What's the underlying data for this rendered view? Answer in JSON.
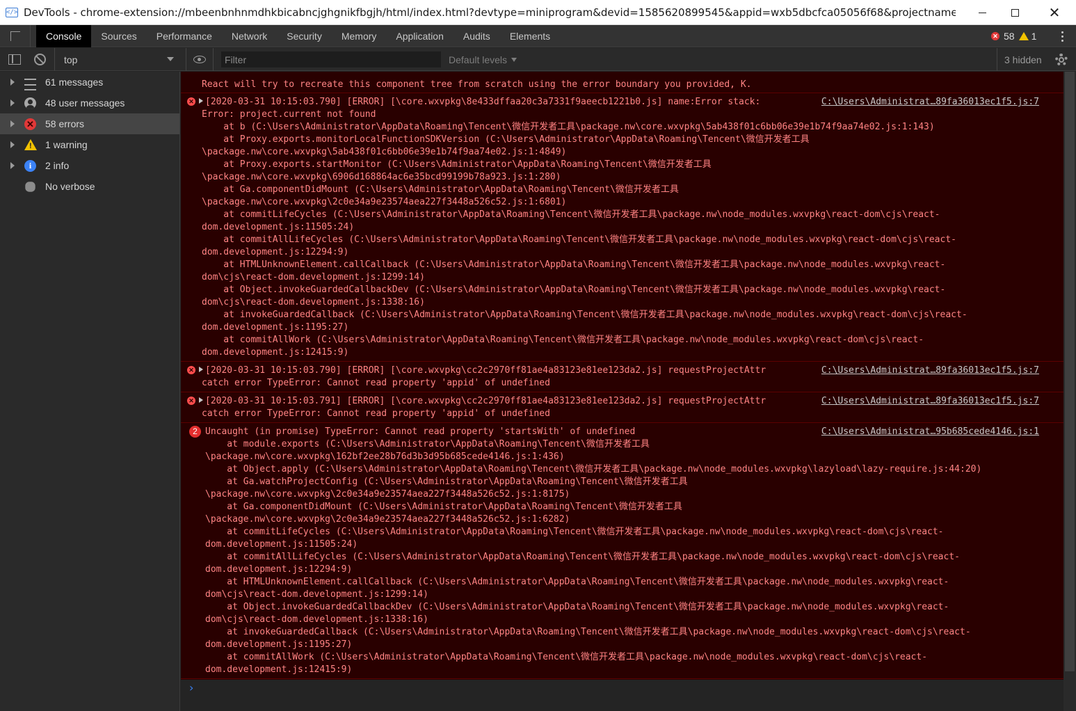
{
  "window": {
    "title": "DevTools - chrome-extension://mbeenbnhnmdhkbicabncjghgnikfbgjh/html/index.html?devtype=miniprogram&devid=1585620899545&appid=wxb5dbcfca05056f68&projectname=%E..."
  },
  "tabs": [
    {
      "label": "Console",
      "active": true
    },
    {
      "label": "Sources"
    },
    {
      "label": "Performance"
    },
    {
      "label": "Network"
    },
    {
      "label": "Security"
    },
    {
      "label": "Memory"
    },
    {
      "label": "Application"
    },
    {
      "label": "Audits"
    },
    {
      "label": "Elements"
    }
  ],
  "counters": {
    "errors": "58",
    "warnings": "1"
  },
  "toolbar": {
    "context": "top",
    "filter_placeholder": "Filter",
    "levels": "Default levels",
    "hidden": "3 hidden"
  },
  "sidebar": {
    "items": [
      {
        "label": "61 messages",
        "icon": "list-icon"
      },
      {
        "label": "48 user messages",
        "icon": "user-icon"
      },
      {
        "label": "58 errors",
        "icon": "error-icon",
        "selected": true
      },
      {
        "label": "1 warning",
        "icon": "warning-icon"
      },
      {
        "label": "2 info",
        "icon": "info-icon"
      },
      {
        "label": "No verbose",
        "icon": "bug-icon"
      }
    ]
  },
  "console": {
    "messages": [
      {
        "kind": "text",
        "lines": [
          "React will try to recreate this component tree from scratch using the error boundary you provided, K."
        ]
      },
      {
        "kind": "error",
        "expandable": true,
        "source": "C:\\Users\\Administrat…89fa36013ec1f5.js:7",
        "lines": [
          "[2020-03-31 10:15:03.790] [ERROR] [\\core.wxvpkg\\8e433dffaa20c3a7331f9aeecb1221b0.js] name:Error stack:",
          "Error: project.current not found",
          "    at b (C:\\Users\\Administrator\\AppData\\Roaming\\Tencent\\微信开发者工具\\package.nw\\core.wxvpkg\\5ab438f01c6bb06e39e1b74f9aa74e02.js:1:143)",
          "    at Proxy.exports.monitorLocalFunctionSDKVersion (C:\\Users\\Administrator\\AppData\\Roaming\\Tencent\\微信开发者工具",
          "\\package.nw\\core.wxvpkg\\5ab438f01c6bb06e39e1b74f9aa74e02.js:1:4849)",
          "    at Proxy.exports.startMonitor (C:\\Users\\Administrator\\AppData\\Roaming\\Tencent\\微信开发者工具",
          "\\package.nw\\core.wxvpkg\\6906d168864ac6e35bcd99199b78a923.js:1:280)",
          "    at Ga.componentDidMount (C:\\Users\\Administrator\\AppData\\Roaming\\Tencent\\微信开发者工具",
          "\\package.nw\\core.wxvpkg\\2c0e34a9e23574aea227f3448a526c52.js:1:6801)",
          "    at commitLifeCycles (C:\\Users\\Administrator\\AppData\\Roaming\\Tencent\\微信开发者工具\\package.nw\\node_modules.wxvpkg\\react-dom\\cjs\\react-",
          "dom.development.js:11505:24)",
          "    at commitAllLifeCycles (C:\\Users\\Administrator\\AppData\\Roaming\\Tencent\\微信开发者工具\\package.nw\\node_modules.wxvpkg\\react-dom\\cjs\\react-",
          "dom.development.js:12294:9)",
          "    at HTMLUnknownElement.callCallback (C:\\Users\\Administrator\\AppData\\Roaming\\Tencent\\微信开发者工具\\package.nw\\node_modules.wxvpkg\\react-",
          "dom\\cjs\\react-dom.development.js:1299:14)",
          "    at Object.invokeGuardedCallbackDev (C:\\Users\\Administrator\\AppData\\Roaming\\Tencent\\微信开发者工具\\package.nw\\node_modules.wxvpkg\\react-",
          "dom\\cjs\\react-dom.development.js:1338:16)",
          "    at invokeGuardedCallback (C:\\Users\\Administrator\\AppData\\Roaming\\Tencent\\微信开发者工具\\package.nw\\node_modules.wxvpkg\\react-dom\\cjs\\react-",
          "dom.development.js:1195:27)",
          "    at commitAllWork (C:\\Users\\Administrator\\AppData\\Roaming\\Tencent\\微信开发者工具\\package.nw\\node_modules.wxvpkg\\react-dom\\cjs\\react-",
          "dom.development.js:12415:9)"
        ]
      },
      {
        "kind": "error",
        "expandable": true,
        "source": "C:\\Users\\Administrat…89fa36013ec1f5.js:7",
        "lines": [
          "[2020-03-31 10:15:03.790] [ERROR] [\\core.wxvpkg\\cc2c2970ff81ae4a83123e81ee123da2.js] requestProjectAttr",
          "catch error TypeError: Cannot read property 'appid' of undefined"
        ]
      },
      {
        "kind": "error",
        "expandable": true,
        "source": "C:\\Users\\Administrat…89fa36013ec1f5.js:7",
        "lines": [
          "[2020-03-31 10:15:03.791] [ERROR] [\\core.wxvpkg\\cc2c2970ff81ae4a83123e81ee123da2.js] requestProjectAttr",
          "catch error TypeError: Cannot read property 'appid' of undefined"
        ]
      },
      {
        "kind": "uncaught",
        "count": "2",
        "source": "C:\\Users\\Administrat…95b685cede4146.js:1",
        "lines": [
          "Uncaught (in promise) TypeError: Cannot read property 'startsWith' of undefined",
          "    at module.exports (C:\\Users\\Administrator\\AppData\\Roaming\\Tencent\\微信开发者工具",
          "\\package.nw\\core.wxvpkg\\162bf2ee28b76d3b3d95b685cede4146.js:1:436)",
          "    at Object.apply (C:\\Users\\Administrator\\AppData\\Roaming\\Tencent\\微信开发者工具\\package.nw\\node_modules.wxvpkg\\lazyload\\lazy-require.js:44:20)",
          "    at Ga.watchProjectConfig (C:\\Users\\Administrator\\AppData\\Roaming\\Tencent\\微信开发者工具",
          "\\package.nw\\core.wxvpkg\\2c0e34a9e23574aea227f3448a526c52.js:1:8175)",
          "    at Ga.componentDidMount (C:\\Users\\Administrator\\AppData\\Roaming\\Tencent\\微信开发者工具",
          "\\package.nw\\core.wxvpkg\\2c0e34a9e23574aea227f3448a526c52.js:1:6282)",
          "    at commitLifeCycles (C:\\Users\\Administrator\\AppData\\Roaming\\Tencent\\微信开发者工具\\package.nw\\node_modules.wxvpkg\\react-dom\\cjs\\react-",
          "dom.development.js:11505:24)",
          "    at commitAllLifeCycles (C:\\Users\\Administrator\\AppData\\Roaming\\Tencent\\微信开发者工具\\package.nw\\node_modules.wxvpkg\\react-dom\\cjs\\react-",
          "dom.development.js:12294:9)",
          "    at HTMLUnknownElement.callCallback (C:\\Users\\Administrator\\AppData\\Roaming\\Tencent\\微信开发者工具\\package.nw\\node_modules.wxvpkg\\react-",
          "dom\\cjs\\react-dom.development.js:1299:14)",
          "    at Object.invokeGuardedCallbackDev (C:\\Users\\Administrator\\AppData\\Roaming\\Tencent\\微信开发者工具\\package.nw\\node_modules.wxvpkg\\react-",
          "dom\\cjs\\react-dom.development.js:1338:16)",
          "    at invokeGuardedCallback (C:\\Users\\Administrator\\AppData\\Roaming\\Tencent\\微信开发者工具\\package.nw\\node_modules.wxvpkg\\react-dom\\cjs\\react-",
          "dom.development.js:1195:27)",
          "    at commitAllWork (C:\\Users\\Administrator\\AppData\\Roaming\\Tencent\\微信开发者工具\\package.nw\\node_modules.wxvpkg\\react-dom\\cjs\\react-",
          "dom.development.js:12415:9)"
        ]
      }
    ],
    "prompt_glyph": "›"
  },
  "colors": {
    "error_text": "#ff8484",
    "error_bg": "#290000",
    "accent": "#3b82f6",
    "warning": "#f2c200",
    "error": "#e23838"
  }
}
